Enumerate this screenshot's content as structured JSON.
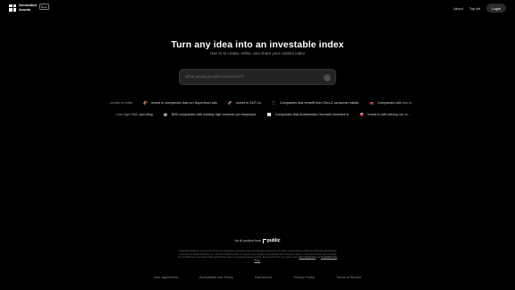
{
  "brand": {
    "name_line1": "Generated",
    "name_line2": "Assets",
    "badge": "Beta"
  },
  "nav": {
    "about": "About",
    "top_list": "Top list",
    "login": "Login"
  },
  "hero": {
    "title": "Turn any idea into an investable index",
    "subtitle": "Use AI to create, refine, and share your custom index"
  },
  "search": {
    "placeholder": "What would you like to invest in?"
  },
  "suggestions_row1": [
    {
      "icon": "spark-icon",
      "glyph": "",
      "label": "...wealth to retire"
    },
    {
      "icon": "football-icon",
      "glyph": "🏈",
      "label": "Invest in companies that run Superbowl ads"
    },
    {
      "icon": "rocket-icon",
      "glyph": "🚀",
      "label": "Invest in GLP-1s"
    },
    {
      "icon": "phone-icon",
      "glyph": "📱",
      "label": "Companies that benefit from Gen-Z consumer habits"
    },
    {
      "icon": "car-icon",
      "glyph": "🚗",
      "label": "Companies with low m..."
    }
  ],
  "suggestions_row2": [
    {
      "icon": "lab-icon",
      "glyph": "",
      "label": "...with high R&D spending"
    },
    {
      "icon": "robot-icon",
      "glyph": "🤖",
      "label": "B2B companies with notably high revenue per employee"
    },
    {
      "icon": "chart-icon",
      "glyph": "📈",
      "label": "Companies that Andreessen Horowitz invested in"
    },
    {
      "icon": "car-icon",
      "glyph": "🚘",
      "label": "Invest in self-driving car ce..."
    }
  ],
  "product": {
    "prefix": "An AI product from",
    "brand": "public"
  },
  "disclaimer": {
    "text": "Generated Assets is an AI-powered tool for generating investment ideas. Brokerage services for US-listed, registered securities are offered to self-directed customers by Public Investing, Inc. member FINRA & SIPC. AI outputs may contain errors and are not investment advice. Investing involves risk, including the possible loss of principal. Past performance does not guarantee future results. By using this tool, you agree to the",
    "link1": "User Agreement",
    "and": "and",
    "link2": "Acceptable Use Policy"
  },
  "footer": {
    "links": [
      "User Agreement",
      "Acceptable Use Policy",
      "Disclosures",
      "Privacy Policy",
      "Terms of Service"
    ]
  }
}
